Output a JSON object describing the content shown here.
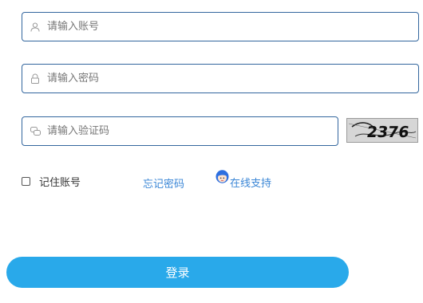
{
  "form": {
    "username": {
      "placeholder": "请输入账号",
      "value": "",
      "icon": "user-icon"
    },
    "password": {
      "placeholder": "请输入密码",
      "value": "",
      "icon": "lock-icon"
    },
    "captcha": {
      "placeholder": "请输入验证码",
      "value": "",
      "icon": "chat-bubbles-icon",
      "image_text": "2376"
    }
  },
  "remember": {
    "label": "记住账号",
    "checked": false
  },
  "links": {
    "forgot": "忘记密码",
    "support": "在线支持"
  },
  "login": {
    "label": "登录"
  },
  "colors": {
    "field_border": "#33669e",
    "link": "#3a86d6",
    "button": "#29a9ea",
    "button_text": "#ffffff"
  }
}
